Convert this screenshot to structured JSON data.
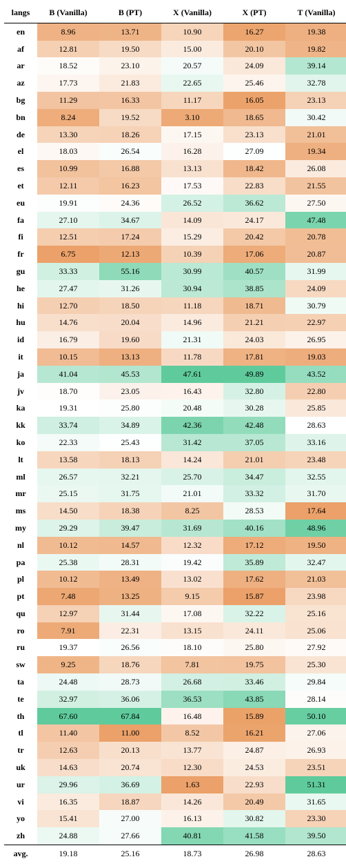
{
  "chart_data": {
    "type": "heatmap",
    "title": "",
    "columns": [
      "langs",
      "B (Vanilla)",
      "B (PT)",
      "X (Vanilla)",
      "X (PT)",
      "T (Vanilla)"
    ],
    "color_scale_note": "Per-column diverging scale: low values shaded orange, high values shaded green, mid values near white.",
    "rows": [
      {
        "lang": "en",
        "values": [
          8.96,
          13.71,
          10.9,
          16.27,
          19.38
        ]
      },
      {
        "lang": "af",
        "values": [
          12.81,
          19.5,
          15.0,
          20.1,
          19.82
        ]
      },
      {
        "lang": "ar",
        "values": [
          18.52,
          23.1,
          20.57,
          24.09,
          39.14
        ]
      },
      {
        "lang": "az",
        "values": [
          17.73,
          21.83,
          22.65,
          25.46,
          32.78
        ]
      },
      {
        "lang": "bg",
        "values": [
          11.29,
          16.33,
          11.17,
          16.05,
          23.13
        ]
      },
      {
        "lang": "bn",
        "values": [
          8.24,
          19.52,
          3.1,
          18.65,
          30.42
        ]
      },
      {
        "lang": "de",
        "values": [
          13.3,
          18.26,
          17.15,
          23.13,
          21.01
        ]
      },
      {
        "lang": "el",
        "values": [
          18.03,
          26.54,
          16.28,
          27.09,
          19.34
        ]
      },
      {
        "lang": "es",
        "values": [
          10.99,
          16.88,
          13.13,
          18.42,
          26.08
        ]
      },
      {
        "lang": "et",
        "values": [
          12.11,
          16.23,
          17.53,
          22.83,
          21.55
        ]
      },
      {
        "lang": "eu",
        "values": [
          19.91,
          24.36,
          26.52,
          36.62,
          27.5
        ]
      },
      {
        "lang": "fa",
        "values": [
          27.1,
          34.67,
          14.09,
          24.17,
          47.48
        ]
      },
      {
        "lang": "fi",
        "values": [
          12.51,
          17.24,
          15.29,
          20.42,
          20.78
        ]
      },
      {
        "lang": "fr",
        "values": [
          6.75,
          12.13,
          10.39,
          17.06,
          20.87
        ]
      },
      {
        "lang": "gu",
        "values": [
          33.33,
          55.16,
          30.99,
          40.57,
          31.99
        ]
      },
      {
        "lang": "he",
        "values": [
          27.47,
          31.26,
          30.94,
          38.85,
          24.09
        ]
      },
      {
        "lang": "hi",
        "values": [
          12.7,
          18.5,
          11.18,
          18.71,
          30.79
        ]
      },
      {
        "lang": "hu",
        "values": [
          14.76,
          20.04,
          14.96,
          21.21,
          22.97
        ]
      },
      {
        "lang": "id",
        "values": [
          16.79,
          19.6,
          21.31,
          24.03,
          26.95
        ]
      },
      {
        "lang": "it",
        "values": [
          10.15,
          13.13,
          11.78,
          17.81,
          19.03
        ]
      },
      {
        "lang": "ja",
        "values": [
          41.04,
          45.53,
          47.61,
          49.89,
          43.52
        ]
      },
      {
        "lang": "jv",
        "values": [
          18.7,
          23.05,
          16.43,
          32.8,
          22.8
        ]
      },
      {
        "lang": "ka",
        "values": [
          19.31,
          25.8,
          20.48,
          30.28,
          25.85
        ]
      },
      {
        "lang": "kk",
        "values": [
          33.74,
          34.89,
          42.36,
          42.48,
          28.63
        ]
      },
      {
        "lang": "ko",
        "values": [
          22.33,
          25.43,
          31.42,
          37.05,
          33.16
        ]
      },
      {
        "lang": "lt",
        "values": [
          13.58,
          18.13,
          14.24,
          21.01,
          23.48
        ]
      },
      {
        "lang": "ml",
        "values": [
          26.57,
          32.21,
          25.7,
          34.47,
          32.55
        ]
      },
      {
        "lang": "mr",
        "values": [
          25.15,
          31.75,
          21.01,
          33.32,
          31.7
        ]
      },
      {
        "lang": "ms",
        "values": [
          14.5,
          18.38,
          8.25,
          28.53,
          17.64
        ]
      },
      {
        "lang": "my",
        "values": [
          29.29,
          39.47,
          31.69,
          40.16,
          48.96
        ]
      },
      {
        "lang": "nl",
        "values": [
          10.12,
          14.57,
          12.32,
          17.12,
          19.5
        ]
      },
      {
        "lang": "pa",
        "values": [
          25.38,
          28.31,
          19.42,
          35.89,
          32.47
        ]
      },
      {
        "lang": "pl",
        "values": [
          10.12,
          13.49,
          13.02,
          17.62,
          21.03
        ]
      },
      {
        "lang": "pt",
        "values": [
          7.48,
          13.25,
          9.15,
          15.87,
          23.98
        ]
      },
      {
        "lang": "qu",
        "values": [
          12.97,
          31.44,
          17.08,
          32.22,
          25.16
        ]
      },
      {
        "lang": "ro",
        "values": [
          7.91,
          22.31,
          13.15,
          24.11,
          25.06
        ]
      },
      {
        "lang": "ru",
        "values": [
          19.37,
          26.56,
          18.1,
          25.8,
          27.92
        ]
      },
      {
        "lang": "sw",
        "values": [
          9.25,
          18.76,
          7.81,
          19.75,
          25.3
        ]
      },
      {
        "lang": "ta",
        "values": [
          24.48,
          28.73,
          26.68,
          33.46,
          29.84
        ]
      },
      {
        "lang": "te",
        "values": [
          32.97,
          36.06,
          36.53,
          43.85,
          28.14
        ]
      },
      {
        "lang": "th",
        "values": [
          67.6,
          67.84,
          16.48,
          15.89,
          50.1
        ]
      },
      {
        "lang": "tl",
        "values": [
          11.4,
          11.0,
          8.52,
          16.21,
          27.06
        ]
      },
      {
        "lang": "tr",
        "values": [
          12.63,
          20.13,
          13.77,
          24.87,
          26.93
        ]
      },
      {
        "lang": "uk",
        "values": [
          14.63,
          20.74,
          12.3,
          24.53,
          23.51
        ]
      },
      {
        "lang": "ur",
        "values": [
          29.96,
          36.69,
          1.63,
          22.93,
          51.31
        ]
      },
      {
        "lang": "vi",
        "values": [
          16.35,
          18.87,
          14.26,
          20.49,
          31.65
        ]
      },
      {
        "lang": "yo",
        "values": [
          15.41,
          27.0,
          16.13,
          30.82,
          23.3
        ]
      },
      {
        "lang": "zh",
        "values": [
          24.88,
          27.66,
          40.81,
          41.58,
          39.5
        ]
      }
    ],
    "summary": {
      "lang": "avg.",
      "values": [
        19.18,
        25.16,
        18.73,
        26.98,
        28.63
      ]
    }
  }
}
